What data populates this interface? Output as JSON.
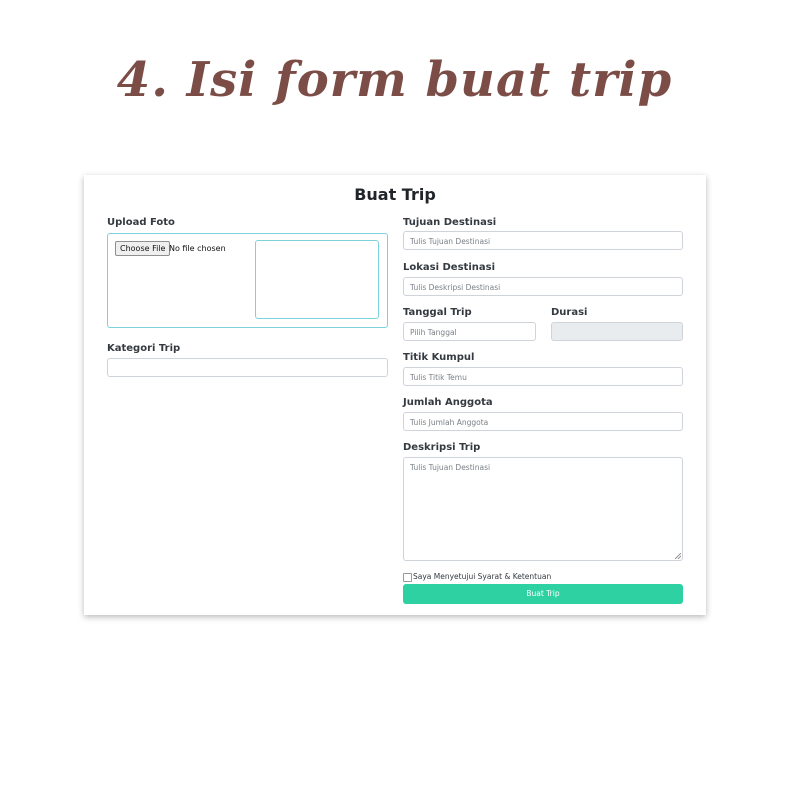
{
  "headline": "4. Isi form buat trip",
  "form": {
    "title": "Buat Trip",
    "upload": {
      "label": "Upload Foto",
      "button_label": "Choose File",
      "status": "No file chosen"
    },
    "kategori": {
      "label": "Kategori Trip",
      "value": ""
    },
    "tujuan": {
      "label": "Tujuan Destinasi",
      "placeholder": "Tulis Tujuan Destinasi"
    },
    "lokasi": {
      "label": "Lokasi Destinasi",
      "placeholder": "Tulis Deskripsi Destinasi"
    },
    "tanggal": {
      "label": "Tanggal Trip",
      "placeholder": "Pilih Tanggal"
    },
    "durasi": {
      "label": "Durasi",
      "value": ""
    },
    "titik_kumpul": {
      "label": "Titik Kumpul",
      "placeholder": "Tulis Titik Temu"
    },
    "jumlah_anggota": {
      "label": "Jumlah Anggota",
      "placeholder": "Tulis Jumlah Anggota"
    },
    "deskripsi": {
      "label": "Deskripsi Trip",
      "placeholder": "Tulis Tujuan Destinasi"
    },
    "agreement": {
      "label": "Saya Menyetujui Syarat & Ketentuan",
      "checked": false
    },
    "submit_label": "Buat Trip"
  },
  "colors": {
    "headline": "#7b4d46",
    "accent": "#2ed2a2",
    "upload_border": "#7dd3dd",
    "input_border": "#ced4da",
    "disabled_bg": "#e9ecef"
  }
}
